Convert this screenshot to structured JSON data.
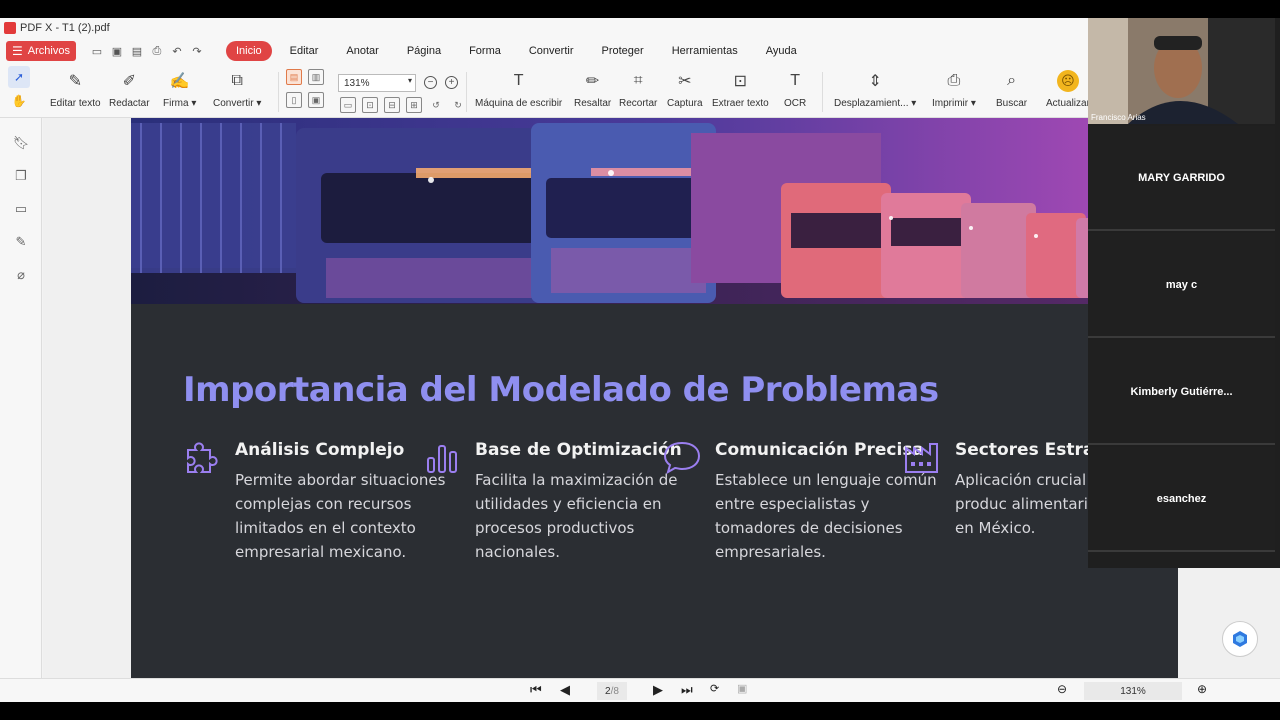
{
  "window": {
    "title": "PDF X - T1 (2).pdf"
  },
  "menu": {
    "file_label": "Archivos",
    "items": [
      "Inicio",
      "Editar",
      "Anotar",
      "Página",
      "Forma",
      "Convertir",
      "Proteger",
      "Herramientas",
      "Ayuda"
    ],
    "active": "Inicio"
  },
  "toolbar": {
    "edit_text": "Editar texto",
    "redact": "Redactar",
    "sign": "Firma",
    "convert": "Convertir",
    "zoom": "131%",
    "typewriter": "Máquina de escribir",
    "highlight": "Resaltar",
    "crop": "Recortar",
    "capture": "Captura",
    "extract_text": "Extraer texto",
    "ocr": "OCR",
    "scroll": "Desplazamient...",
    "print": "Imprimir",
    "search": "Buscar",
    "update": "Actualizar"
  },
  "document": {
    "title": "Importancia del Modelado de Problemas",
    "columns": [
      {
        "heading": "Análisis Complejo",
        "body": "Permite abordar situaciones complejas con recursos limitados en el contexto empresarial mexicano.",
        "icon": "puzzle-icon"
      },
      {
        "heading": "Base de Optimización",
        "body": "Facilita la maximización de utilidades y eficiencia en procesos productivos nacionales.",
        "icon": "bar-chart-icon"
      },
      {
        "heading": "Comunicación Precisa",
        "body": "Establece un lenguaje común entre especialistas y tomadores de decisiones empresariales.",
        "icon": "speech-bubble-icon"
      },
      {
        "heading": "Sectores Estratégicos",
        "body": "Aplicación crucial logística, produc alimentaria y energía en México.",
        "icon": "factory-icon"
      }
    ],
    "accent_color": "#8f8ff0"
  },
  "status": {
    "page": "2",
    "total": "/8",
    "zoom": "131%"
  },
  "video": {
    "self_name": "Francisco Arias",
    "participants": [
      "MARY GARRIDO",
      "may c",
      "Kimberly  Gutiérre...",
      "esanchez"
    ]
  }
}
